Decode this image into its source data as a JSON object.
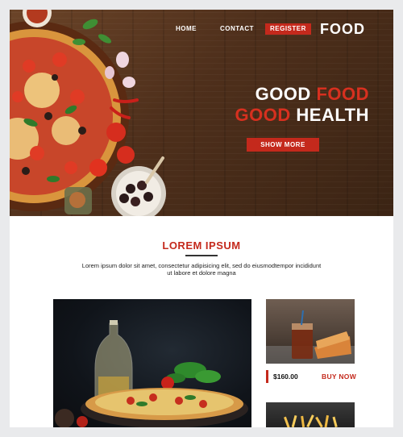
{
  "nav": {
    "home": "HOME",
    "contact": "CONTACT",
    "register": "REGISTER",
    "logo": "FOOD"
  },
  "hero": {
    "line1_white": "GOOD",
    "line1_red": "FOOD",
    "line2_red": "GOOD",
    "line2_white": "HEALTH",
    "cta": "SHOW MORE"
  },
  "section": {
    "title": "LOREM IPSUM",
    "text": "Lorem ipsum dolor sit amet, consectetur adipisicing elit, sed do eiusmodtempor incididunt ut labore et dolore magna"
  },
  "product": {
    "price": "$160.00",
    "buy_label": "BUY NOW"
  },
  "colors": {
    "accent": "#c4291c",
    "wood": "#4e2f1b",
    "page_bg": "#e9eaec"
  },
  "icons": [
    "pizza-image",
    "olives-bowl-image",
    "drink-sandwich-image",
    "fries-image",
    "pizza-oil-image"
  ]
}
